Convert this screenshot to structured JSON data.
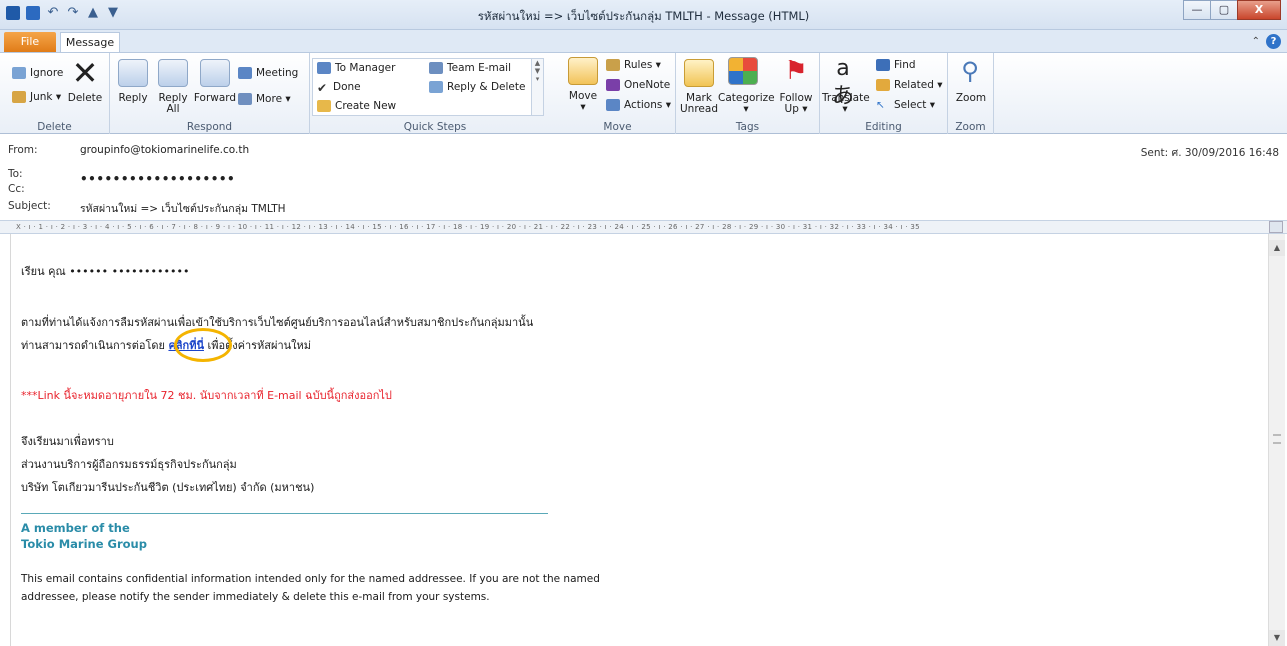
{
  "window": {
    "title": "รหัสผ่านใหม่ => เว็บไซต์ประกันกลุ่ม TMLTH  -  Message (HTML)",
    "minimize": "—",
    "maximize": "▢",
    "close": "X"
  },
  "tabs": {
    "file": "File",
    "message": "Message"
  },
  "help": {
    "caret": "⌃",
    "icon": "?"
  },
  "ribbon": {
    "delete_group": {
      "label": "Delete",
      "ignore": "Ignore",
      "junk": "Junk ▾",
      "delete": "Delete"
    },
    "respond_group": {
      "label": "Respond",
      "reply": "Reply",
      "reply_all_1": "Reply",
      "reply_all_2": "All",
      "forward": "Forward",
      "meeting": "Meeting",
      "more": "More ▾"
    },
    "quick_steps": {
      "label": "Quick Steps",
      "to_manager": "To Manager",
      "done": "Done",
      "create_new": "Create New",
      "team_email": "Team E-mail",
      "reply_delete": "Reply & Delete"
    },
    "move_group": {
      "label": "Move",
      "move": "Move",
      "move_caret": "▾",
      "rules": "Rules ▾",
      "onenote": "OneNote",
      "actions": "Actions ▾"
    },
    "tags_group": {
      "label": "Tags",
      "mark_unread_1": "Mark",
      "mark_unread_2": "Unread",
      "categorize": "Categorize",
      "categorize_caret": "▾",
      "follow_up_1": "Follow",
      "follow_up_2": "Up ▾"
    },
    "editing_group": {
      "label": "Editing",
      "translate": "Translate",
      "translate_caret": "▾",
      "find": "Find",
      "related": "Related ▾",
      "select": "Select ▾"
    },
    "zoom_group": {
      "label": "Zoom",
      "zoom": "Zoom"
    }
  },
  "header": {
    "from_label": "From:",
    "from_value": "groupinfo@tokiomarinelife.co.th",
    "to_label": "To:",
    "to_value": "•••••••••••••••••••",
    "cc_label": "Cc:",
    "subject_label": "Subject:",
    "subject_value": "รหัสผ่านใหม่ => เว็บไซต์ประกันกลุ่ม TMLTH",
    "sent": "Sent:   ศ. 30/09/2016 16:48"
  },
  "ruler": "X · ı · 1 · ı · 2 · ı · 3 · ı · 4 · ı · 5 · ı · 6 · ı · 7 · ı · 8 · ı · 9 · ı · 10 · ı · 11 · ı · 12 · ı · 13 · ı · 14 · ı · 15 · ı · 16 · ı · 17 · ı · 18 · ı · 19 · ı · 20 · ı · 21 · ı · 22 · ı · 23 · ı · 24 · ı · 25 · ı · 26 · ı · 27 · ı · 28 · ı · 29 · ı · 30 · ı · 31 · ı · 32 · ı · 33 · ı · 34 · ı · 35",
  "body": {
    "greeting": "เรียน คุณ  ••••••  ••••••••••••",
    "line1": "ตามที่ท่านได้แจ้งการลืมรหัสผ่านเพื่อเข้าใช้บริการเว็บไซต์ศูนย์บริการออนไลน์สำหรับสมาชิกประกันกลุ่มมานั้น",
    "line2_pre": "ท่านสามารถดำเนินการต่อโดย ",
    "line2_link": "คลิกที่นี่",
    "line2_post": " เพื่อตั้งค่ารหัสผ่านใหม่",
    "warning": "***Link นี้จะหมดอายุภายใน 72 ชม. นับจากเวลาที่ E-mail ฉบับนี้ถูกส่งออกไป",
    "closing": "จึงเรียนมาเพื่อทราบ",
    "dept": "ส่วนงานบริการผู้ถือกรมธรรม์ธุรกิจประกันกลุ่ม",
    "company": "บริษัท โตเกียวมารีนประกันชีวิต (ประเทศไทย) จำกัด (มหาชน)",
    "member1": "A member of the",
    "member2": "Tokio Marine Group",
    "disclaimer1": "This email contains confidential information intended only for the named addressee. If you are not the named",
    "disclaimer2": "addressee, please notify the sender immediately & delete this e-mail from your systems."
  },
  "scroll": {
    "up": "▲",
    "down": "▼"
  }
}
